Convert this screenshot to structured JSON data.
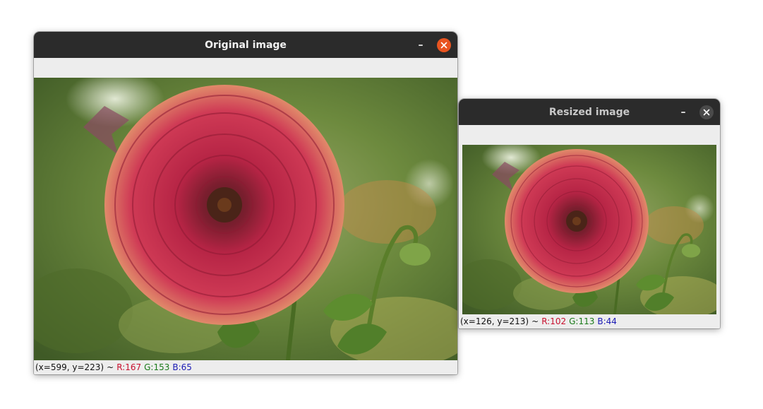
{
  "windows": {
    "original": {
      "title": "Original image",
      "minimize_glyph": "–",
      "close_icon": "x-icon",
      "close_color": "#e95420",
      "status": {
        "coords": "(x=599, y=223)",
        "sep": "~",
        "r": "R:167",
        "g": "G:153",
        "b": "B:65"
      }
    },
    "resized": {
      "title": "Resized image",
      "minimize_glyph": "–",
      "close_icon": "x-icon",
      "close_color": "#4a4a4a",
      "status": {
        "coords": "(x=126, y=213)",
        "sep": "~",
        "r": "R:102",
        "g": "G:113",
        "b": "B:44"
      }
    }
  },
  "colors": {
    "red_channel": "#c8102e",
    "green_channel": "#1a7a1a",
    "blue_channel": "#1a1ab4"
  }
}
